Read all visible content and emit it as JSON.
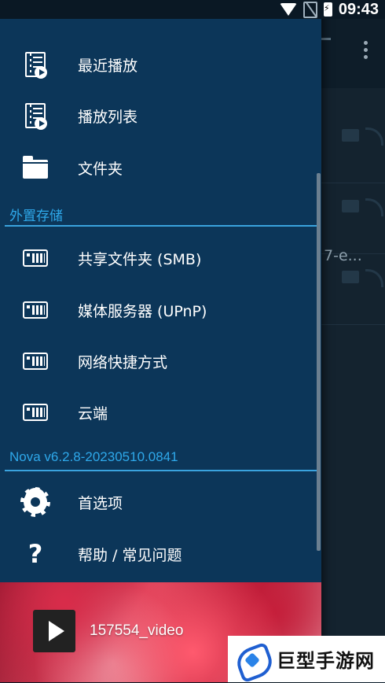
{
  "status_bar": {
    "time": "09:43"
  },
  "drawer": {
    "library_items": [
      {
        "label": "最近播放",
        "icon": "film-play-icon"
      },
      {
        "label": "播放列表",
        "icon": "film-play-icon"
      },
      {
        "label": "文件夹",
        "icon": "folder-icon"
      }
    ],
    "external_storage": {
      "header": "外置存储",
      "items": [
        {
          "label": "共享文件夹 (SMB)",
          "icon": "nas-icon"
        },
        {
          "label": "媒体服务器 (UPnP)",
          "icon": "nas-icon"
        },
        {
          "label": "网络快捷方式",
          "icon": "nas-icon"
        },
        {
          "label": "云端",
          "icon": "nas-icon"
        }
      ]
    },
    "version_section": {
      "header": "Nova v6.2.8-20230510.0841",
      "items": [
        {
          "label": "首选项",
          "icon": "gear-icon"
        },
        {
          "label": "帮助 / 常见问题",
          "icon": "help-icon"
        }
      ]
    }
  },
  "now_playing": {
    "title": "157554_video"
  },
  "background": {
    "truncated_text": "7-e..."
  },
  "watermark": {
    "text": "巨型手游网"
  },
  "colors": {
    "drawer_bg": "#0c3659",
    "accent": "#2ea8ea",
    "text": "#ffffff"
  }
}
